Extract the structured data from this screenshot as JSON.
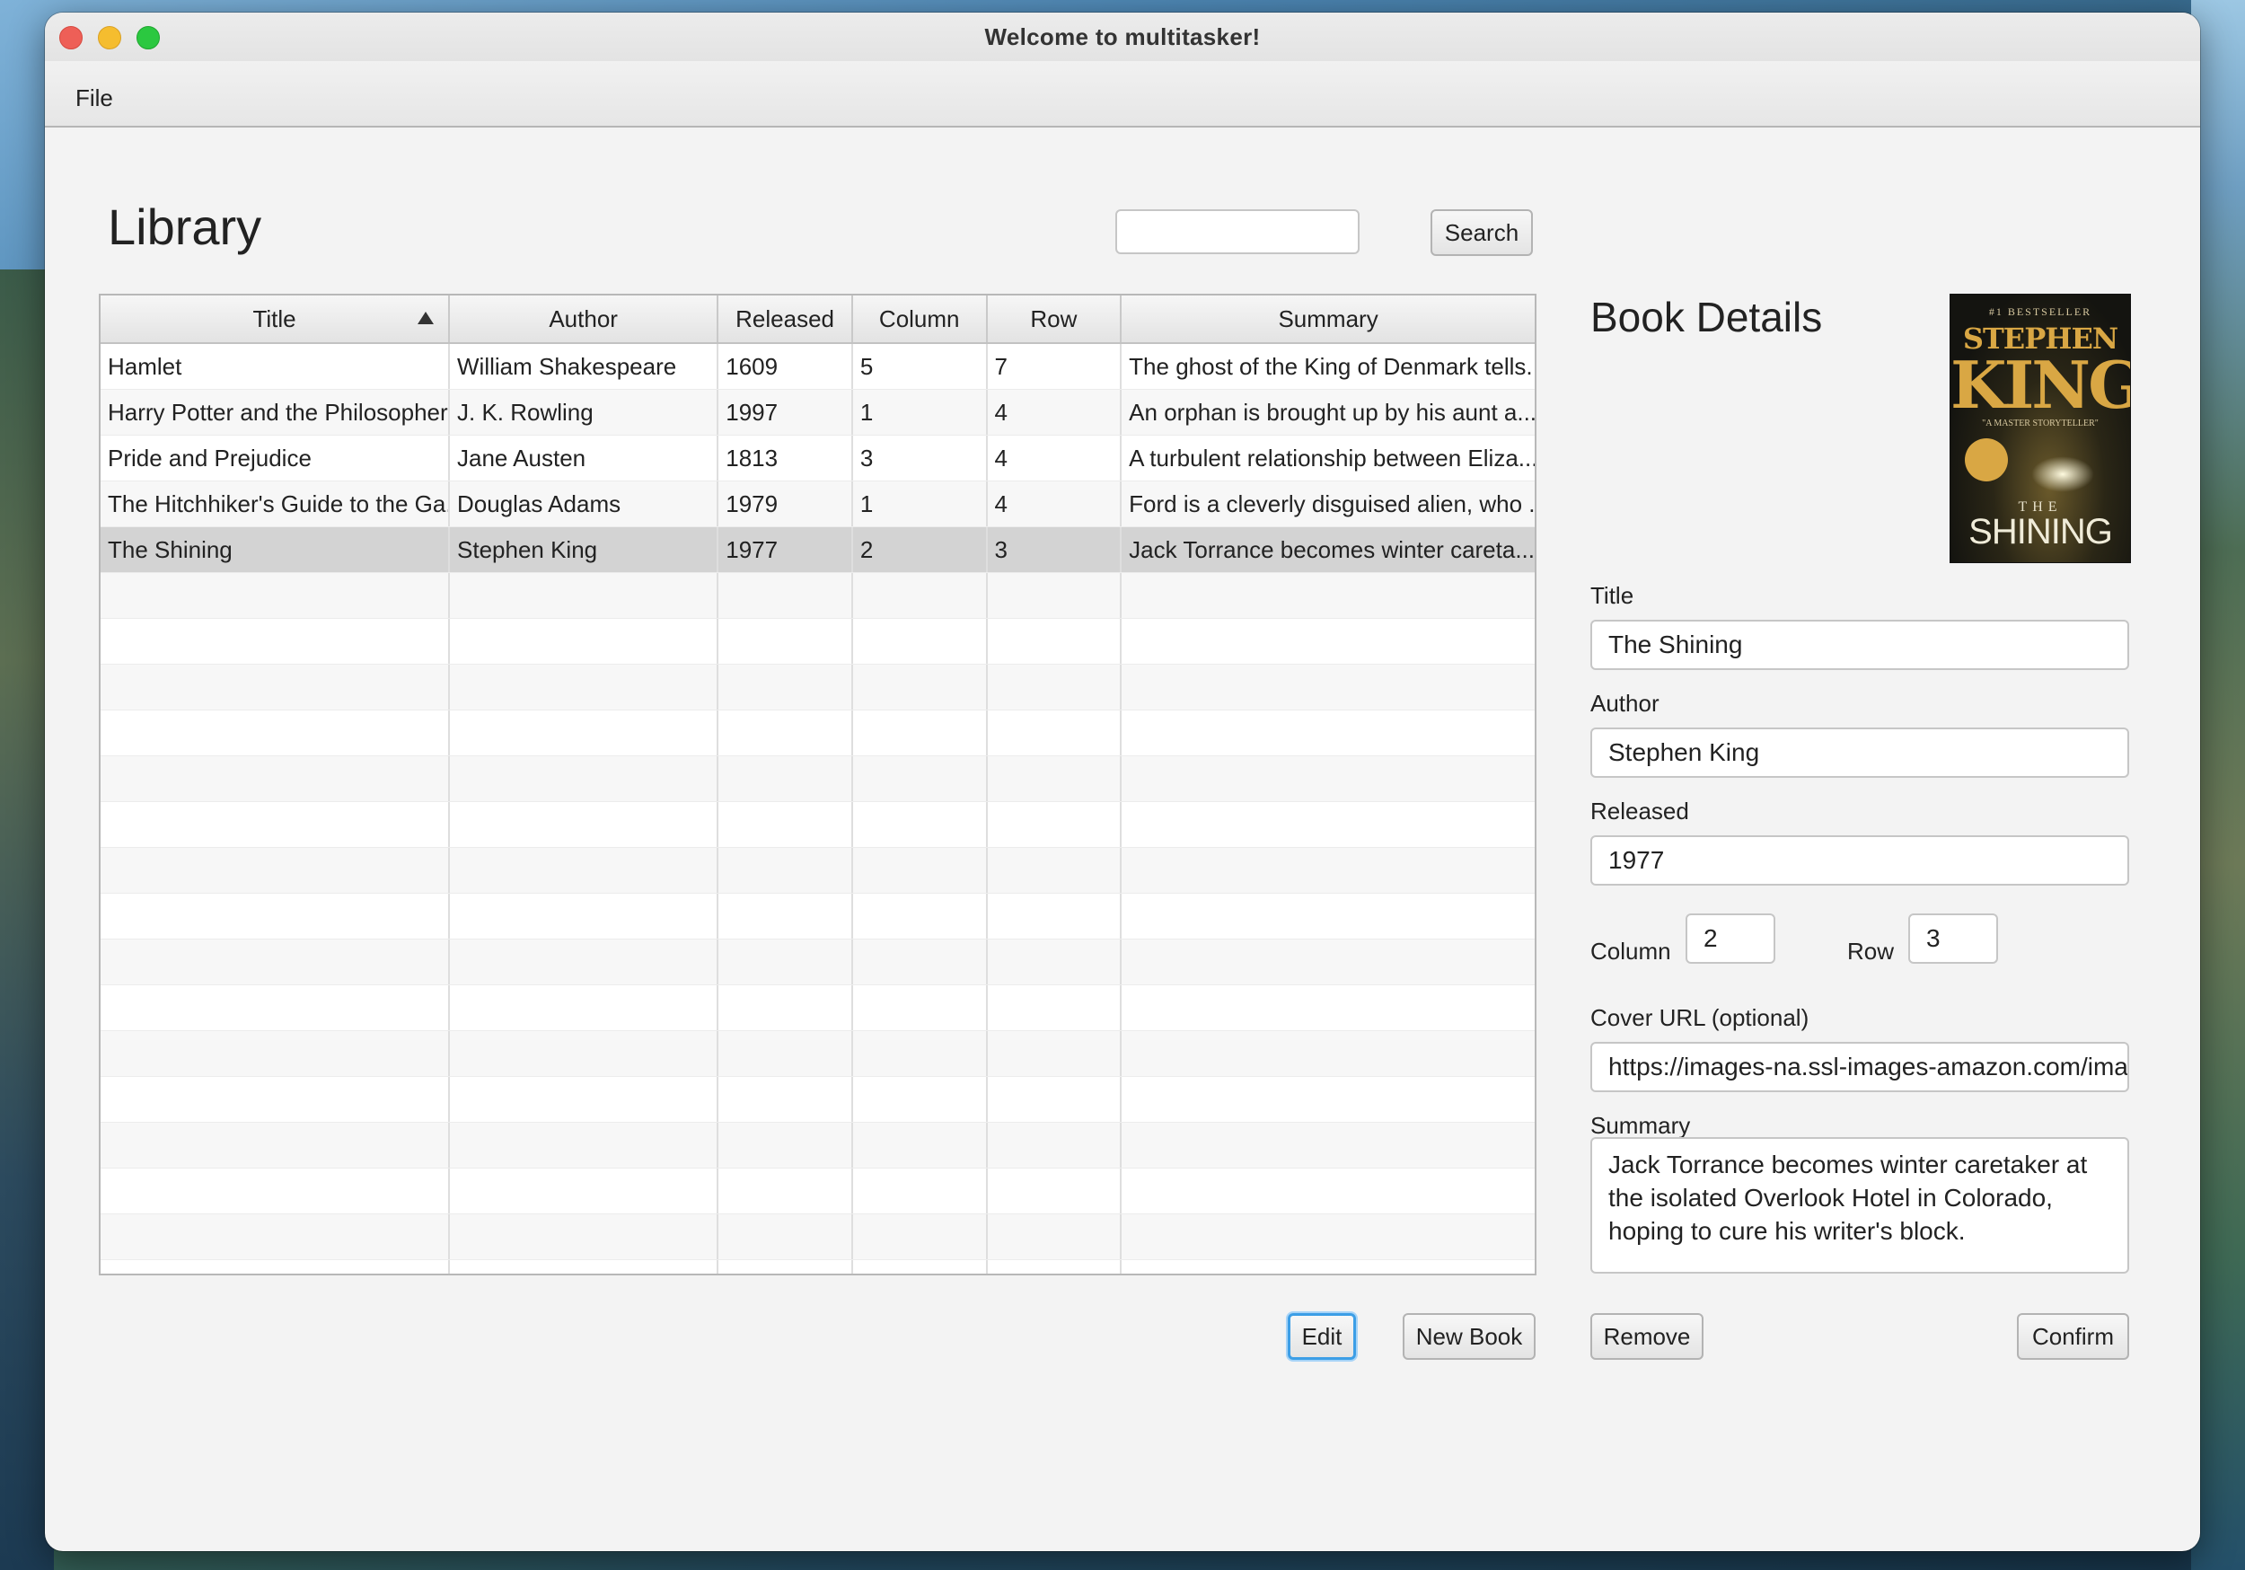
{
  "window": {
    "title": "Welcome to multitasker!"
  },
  "menu": {
    "file": "File"
  },
  "library": {
    "heading": "Library",
    "search_value": "",
    "search_button": "Search",
    "columns": [
      "Title",
      "Author",
      "Released",
      "Column",
      "Row",
      "Summary"
    ],
    "sorted_column": "Title",
    "sort_direction": "ascending",
    "rows": [
      [
        "Hamlet",
        "William Shakespeare",
        "1609",
        "5",
        "7",
        "The ghost of the King of Denmark tells..."
      ],
      [
        "Harry Potter and the Philosopher...",
        "J. K. Rowling",
        "1997",
        "1",
        "4",
        "An orphan is brought up by his aunt a..."
      ],
      [
        "Pride and Prejudice",
        "Jane Austen",
        "1813",
        "3",
        "4",
        "A turbulent relationship between Eliza..."
      ],
      [
        "The Hitchhiker's Guide to the Ga...",
        "Douglas Adams",
        "1979",
        "1",
        "4",
        "Ford is a cleverly disguised alien, who ..."
      ],
      [
        "The Shining",
        "Stephen King",
        "1977",
        "2",
        "3",
        "Jack Torrance becomes winter careta..."
      ]
    ],
    "selected_row": 4,
    "edit_button": "Edit",
    "new_book_button": "New Book"
  },
  "details": {
    "heading": "Book Details",
    "cover": {
      "top_line": "#1 BESTSELLER",
      "author_first": "STEPHEN",
      "author_last": "KING",
      "tagline": "\"A MASTER STORYTELLER\"",
      "the": "THE",
      "title": "SHINING"
    },
    "title_label": "Title",
    "title_value": "The Shining",
    "author_label": "Author",
    "author_value": "Stephen King",
    "released_label": "Released",
    "released_value": "1977",
    "column_label": "Column",
    "column_value": "2",
    "row_label": "Row",
    "row_value": "3",
    "cover_url_label": "Cover URL (optional)",
    "cover_url_value": "https://images-na.ssl-images-amazon.com/imag",
    "summary_label": "Summary",
    "summary_value": "Jack Torrance becomes winter caretaker at the isolated Overlook Hotel in Colorado, hoping to cure his writer's block.",
    "remove_button": "Remove",
    "confirm_button": "Confirm"
  }
}
